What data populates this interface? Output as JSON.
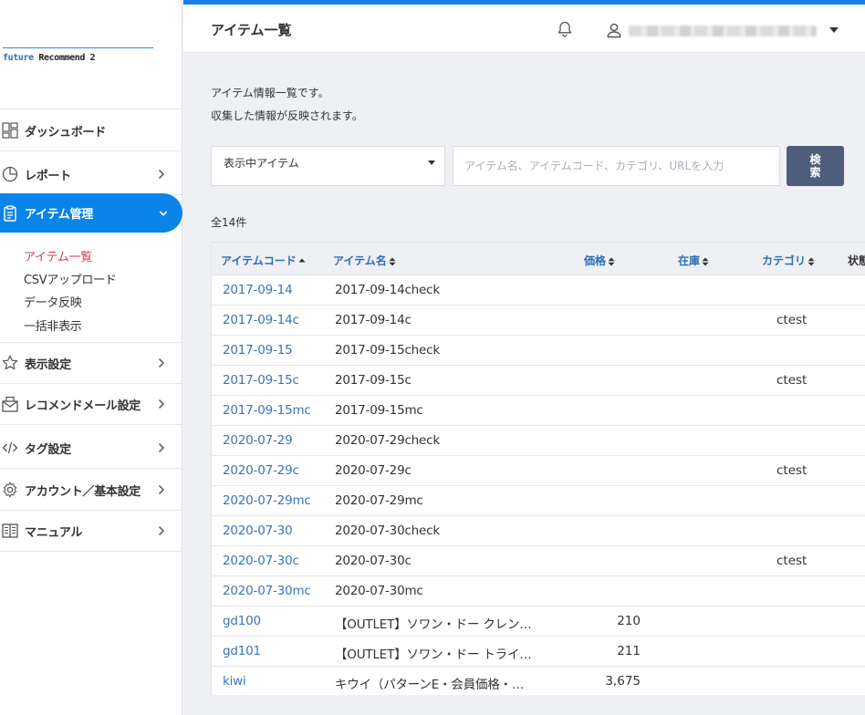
{
  "logo": {
    "prefix": "future",
    "rest": " Recommend 2"
  },
  "sidebar": {
    "items": [
      {
        "key": "dashboard",
        "label": "ダッシュボード",
        "icon": "dashboard-grid-icon",
        "chevron": false
      },
      {
        "key": "report",
        "label": "レポート",
        "icon": "pie-chart-icon",
        "chevron": true
      },
      {
        "key": "item-management",
        "label": "アイテム管理",
        "icon": "clipboard-icon",
        "chevron": true,
        "active": true
      },
      {
        "key": "display-settings",
        "label": "表示設定",
        "icon": "star-icon",
        "chevron": true
      },
      {
        "key": "recommend-mail",
        "label": "レコメンドメール設定",
        "icon": "envelope-icon",
        "chevron": true
      },
      {
        "key": "tag-settings",
        "label": "タグ設定",
        "icon": "code-icon",
        "chevron": true
      },
      {
        "key": "account-settings",
        "label": "アカウント／基本設定",
        "icon": "gear-icon",
        "chevron": true
      },
      {
        "key": "manual",
        "label": "マニュアル",
        "icon": "book-icon",
        "chevron": true
      }
    ],
    "submenu": [
      {
        "label": "アイテム一覧",
        "current": true
      },
      {
        "label": "CSVアップロード"
      },
      {
        "label": "データ反映"
      },
      {
        "label": "一括非表示"
      }
    ]
  },
  "header": {
    "title": "アイテム一覧"
  },
  "main": {
    "description_line1": "アイテム情報一覧です。",
    "description_line2": "収集した情報が反映されます。",
    "filter_select_value": "表示中アイテム",
    "search_placeholder": "アイテム名、アイテムコード、カテゴリ、URLを入力",
    "search_button_label": "検索",
    "total_count": "全14件"
  },
  "table": {
    "columns": {
      "code": "アイテムコード",
      "name": "アイテム名",
      "price": "価格",
      "stock": "在庫",
      "category": "カテゴリ",
      "status": "状態"
    },
    "rows": [
      {
        "code": "2017-09-14",
        "name": "2017-09-14check",
        "price": "",
        "category": ""
      },
      {
        "code": "2017-09-14c",
        "name": "2017-09-14c",
        "price": "",
        "category": "ctest"
      },
      {
        "code": "2017-09-15",
        "name": "2017-09-15check",
        "price": "",
        "category": ""
      },
      {
        "code": "2017-09-15c",
        "name": "2017-09-15c",
        "price": "",
        "category": "ctest"
      },
      {
        "code": "2017-09-15mc",
        "name": "2017-09-15mc",
        "price": "",
        "category": ""
      },
      {
        "code": "2020-07-29",
        "name": "2020-07-29check",
        "price": "",
        "category": ""
      },
      {
        "code": "2020-07-29c",
        "name": "2020-07-29c",
        "price": "",
        "category": "ctest"
      },
      {
        "code": "2020-07-29mc",
        "name": "2020-07-29mc",
        "price": "",
        "category": ""
      },
      {
        "code": "2020-07-30",
        "name": "2020-07-30check",
        "price": "",
        "category": ""
      },
      {
        "code": "2020-07-30c",
        "name": "2020-07-30c",
        "price": "",
        "category": "ctest"
      },
      {
        "code": "2020-07-30mc",
        "name": "2020-07-30mc",
        "price": "",
        "category": ""
      },
      {
        "code": "gd100",
        "name": "【OUTLET】ソワン・ドー クレン…",
        "price": "210",
        "category": ""
      },
      {
        "code": "gd101",
        "name": "【OUTLET】ソワン・ドー トライ…",
        "price": "211",
        "category": ""
      },
      {
        "code": "kiwi",
        "name": "キウイ（パターンE・会員価格・…",
        "price": "3,675",
        "category": ""
      }
    ]
  },
  "colors": {
    "accent": "#0a84e8",
    "link": "#3a74b8",
    "current_submenu": "#d63d5a",
    "search_button": "#4e5d7b"
  }
}
